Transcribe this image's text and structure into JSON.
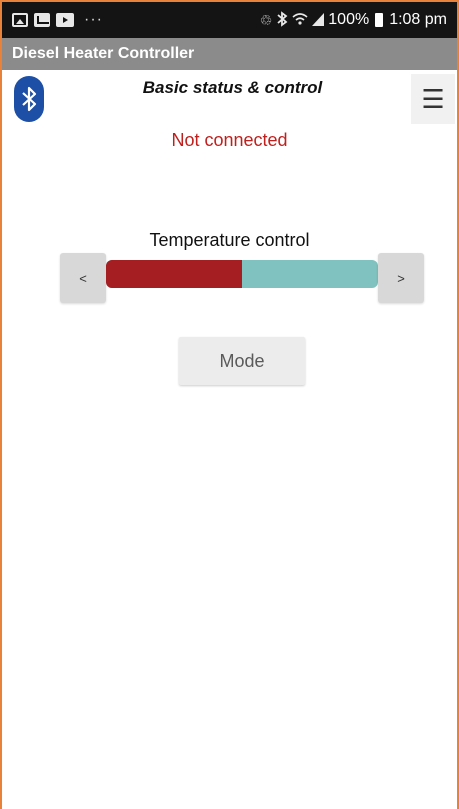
{
  "statusbar": {
    "left_icons": [
      "gallery-icon",
      "mail-icon",
      "video-icon"
    ],
    "more": "···",
    "battery": "100%",
    "time": "1:08 pm"
  },
  "app": {
    "title": "Diesel Heater Controller"
  },
  "main": {
    "heading": "Basic status & control",
    "connection_status": "Not connected",
    "menu_icon": "☰",
    "temperature": {
      "label": "Temperature control",
      "decrease_label": "<",
      "increase_label": ">",
      "level": 0.5
    },
    "mode_label": "Mode"
  },
  "colors": {
    "status_bar": "#141414",
    "title_bar": "#8b8b8b",
    "bluetooth": "#1c4fa5",
    "status_red": "#c0201d",
    "slider_fill": "#a41e22",
    "slider_track": "#7fc2bf"
  }
}
